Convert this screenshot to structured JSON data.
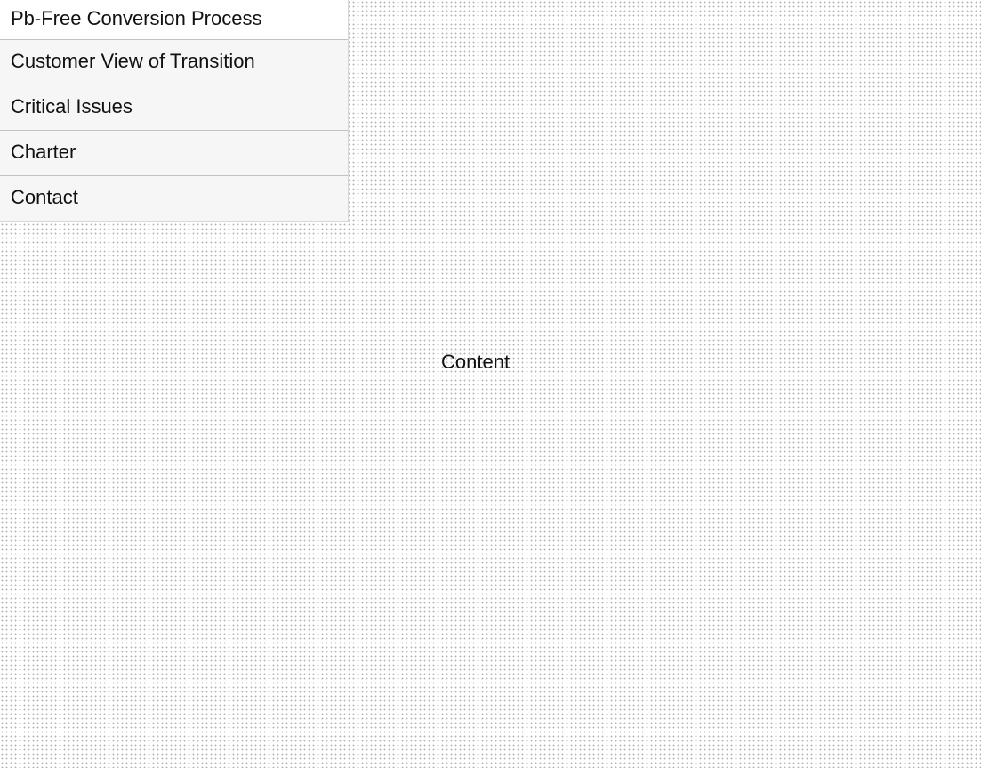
{
  "nav": {
    "items": [
      {
        "label": "Pb-Free Conversion Process"
      },
      {
        "label": "Customer View of Transition"
      },
      {
        "label": "Critical Issues"
      },
      {
        "label": "Charter"
      },
      {
        "label": "Contact"
      }
    ]
  },
  "main": {
    "content_label": "Content"
  },
  "colors": {
    "menu_background": "#f6f6f6",
    "menu_first_background": "#ffffff",
    "divider": "#c2c2c2",
    "text": "#111111",
    "dot_pattern": "#b4b4b4"
  }
}
